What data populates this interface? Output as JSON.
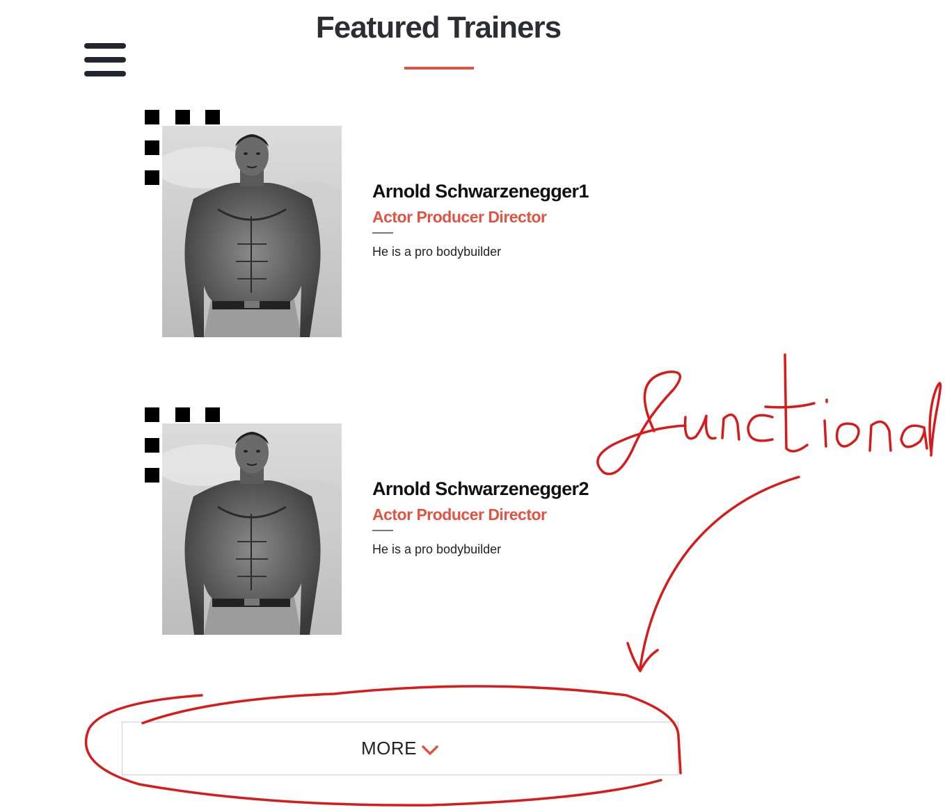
{
  "header": {
    "title": "Featured Trainers"
  },
  "trainers": [
    {
      "name": "Arnold Schwarzenegger1",
      "role": "Actor Producer Director",
      "description": "He is a pro bodybuilder"
    },
    {
      "name": "Arnold Schwarzenegger2",
      "role": "Actor Producer Director",
      "description": "He is a pro bodybuilder"
    }
  ],
  "more_button": {
    "label": "MORE",
    "icon": "chevron-down-icon"
  },
  "annotation": {
    "text": "functional",
    "color": "#d91a1a"
  },
  "colors": {
    "accent": "#e05443",
    "title": "#2d2d34",
    "menu": "#23252f"
  }
}
